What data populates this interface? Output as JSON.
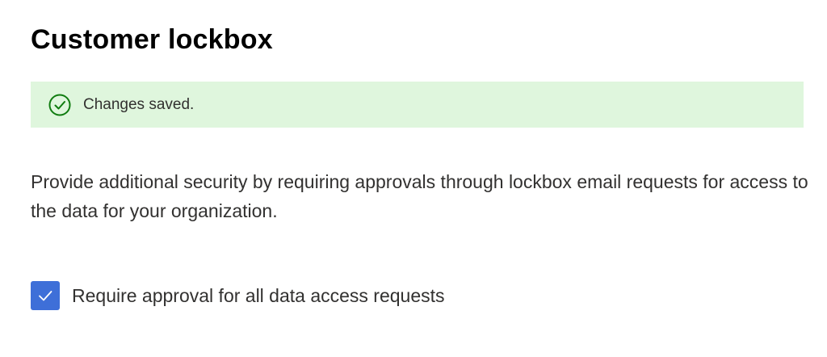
{
  "page": {
    "title": "Customer lockbox"
  },
  "banner": {
    "message": "Changes saved.",
    "icon": "check-circle-icon",
    "background_color": "#dff6dd",
    "icon_color": "#107c10"
  },
  "description": "Provide additional security by requiring approvals through lockbox email requests for access to the data for your organization.",
  "setting": {
    "label": "Require approval for all data access requests",
    "checked": true,
    "icon": "checkmark-icon",
    "checkbox_color": "#3e6fd8"
  }
}
